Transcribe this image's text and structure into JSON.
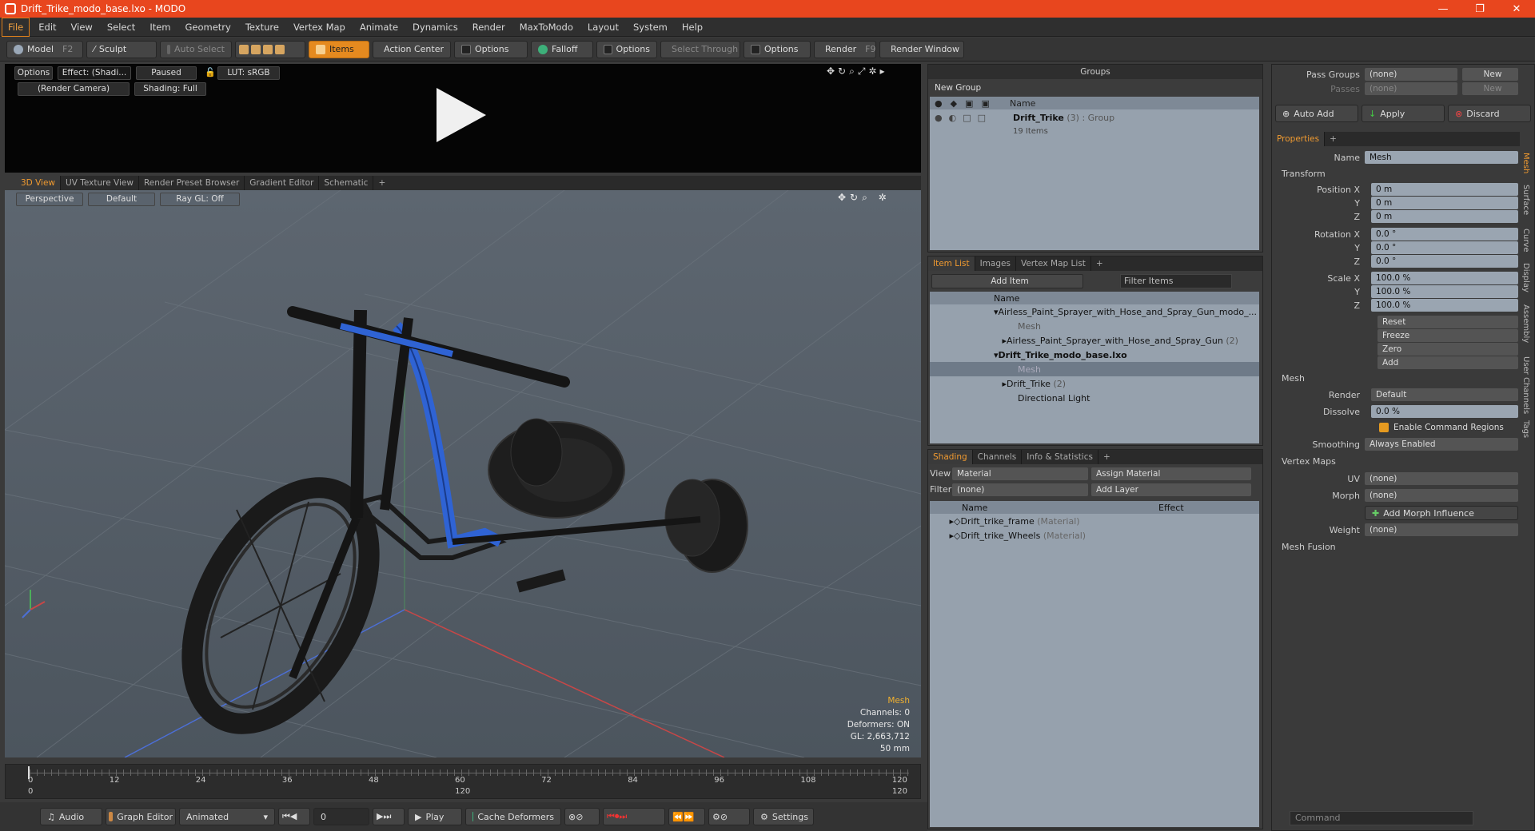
{
  "window": {
    "title": "Drift_Trike_modo_base.lxo - MODO",
    "min": "—",
    "max": "❐",
    "close": "✕"
  },
  "menu": [
    "File",
    "Edit",
    "View",
    "Select",
    "Item",
    "Geometry",
    "Texture",
    "Vertex Map",
    "Animate",
    "Dynamics",
    "Render",
    "MaxToModo",
    "Layout",
    "System",
    "Help"
  ],
  "toolbar": {
    "model": "Model",
    "model_key": "F2",
    "sculpt": "Sculpt",
    "auto_select": "Auto Select",
    "items": "Items",
    "action_center": "Action Center",
    "options1": "Options",
    "falloff": "Falloff",
    "options2": "Options",
    "select_through": "Select Through",
    "options3": "Options",
    "render": "Render",
    "render_key": "F9",
    "render_window": "Render Window"
  },
  "viewer": {
    "options": "Options",
    "effect": "Effect: (Shadi...",
    "paused": "Paused",
    "lut": "LUT: sRGB",
    "camera": "(Render Camera)",
    "shading": "Shading: Full"
  },
  "view_tabs": [
    "3D View",
    "UV Texture View",
    "Render Preset Browser",
    "Gradient Editor",
    "Schematic",
    "+"
  ],
  "viewport": {
    "perspective": "Perspective",
    "default": "Default",
    "raygl": "Ray GL: Off",
    "info_title": "Mesh",
    "channels": "Channels: 0",
    "deformers": "Deformers: ON",
    "gl": "GL: 2,663,712",
    "focal": "50 mm"
  },
  "timeline": {
    "ticks": [
      "0",
      "12",
      "24",
      "36",
      "48",
      "60",
      "72",
      "84",
      "96",
      "108",
      "120"
    ],
    "start": "0",
    "mid": "120",
    "end": "120"
  },
  "transport": {
    "audio": "Audio",
    "graph": "Graph Editor",
    "animated": "Animated",
    "frame": "0",
    "play": "Play",
    "cache": "Cache Deformers",
    "settings": "Settings"
  },
  "groups": {
    "title": "Groups",
    "new_group": "New Group",
    "col_name": "Name",
    "item_name": "Drift_Trike",
    "item_count": "(3)",
    "item_type": ": Group",
    "item_sub": "19 Items"
  },
  "itemlist": {
    "tabs": [
      "Item List",
      "Images",
      "Vertex Map List",
      "+"
    ],
    "add_item": "Add Item",
    "filter": "Filter Items",
    "col_name": "Name",
    "rows": [
      {
        "name": "Airless_Paint_Sprayer_with_Hose_and_Spray_Gun_modo_...",
        "count": ""
      },
      {
        "name": "Mesh",
        "count": ""
      },
      {
        "name": "Airless_Paint_Sprayer_with_Hose_and_Spray_Gun",
        "count": "(2)"
      },
      {
        "name": "Drift_Trike_modo_base.lxo",
        "count": ""
      },
      {
        "name": "Mesh",
        "count": ""
      },
      {
        "name": "Drift_Trike",
        "count": "(2)"
      },
      {
        "name": "Directional Light",
        "count": ""
      }
    ]
  },
  "shading": {
    "tabs": [
      "Shading",
      "Channels",
      "Info & Statistics",
      "+"
    ],
    "view_label": "View",
    "view_value": "Material",
    "assign": "Assign Material",
    "filter_label": "Filter",
    "filter_value": "(none)",
    "add_layer": "Add Layer",
    "col_name": "Name",
    "col_effect": "Effect",
    "rows": [
      {
        "name": "Drift_trike_frame",
        "type": "(Material)"
      },
      {
        "name": "Drift_trike_Wheels",
        "type": "(Material)"
      }
    ]
  },
  "props": {
    "pass_groups": "Pass Groups",
    "passes": "Passes",
    "none": "(none)",
    "new": "New",
    "auto_add": "Auto Add",
    "apply": "Apply",
    "discard": "Discard",
    "tab": "Properties",
    "name_label": "Name",
    "name_value": "Mesh",
    "transform": "Transform",
    "position": "Position X",
    "rotation": "Rotation X",
    "scale": "Scale X",
    "y": "Y",
    "z": "Z",
    "pos": [
      "0 m",
      "0 m",
      "0 m"
    ],
    "rot": [
      "0.0 °",
      "0.0 °",
      "0.0 °"
    ],
    "scl": [
      "100.0 %",
      "100.0 %",
      "100.0 %"
    ],
    "reset": "Reset",
    "freeze": "Freeze",
    "zero": "Zero",
    "add": "Add",
    "mesh": "Mesh",
    "render_label": "Render",
    "render_value": "Default",
    "dissolve_label": "Dissolve",
    "dissolve_value": "0.0 %",
    "enable_regions": "Enable Command Regions",
    "smoothing_label": "Smoothing",
    "smoothing_value": "Always Enabled",
    "vertex_maps": "Vertex Maps",
    "uv": "UV",
    "morph": "Morph",
    "add_morph": "Add Morph Influence",
    "weight": "Weight",
    "mesh_fusion": "Mesh Fusion",
    "command": "Command"
  },
  "side_tabs": [
    "Mesh",
    "Surface",
    "Curve",
    "Display",
    "Assembly",
    "User Channels",
    "Tags"
  ]
}
